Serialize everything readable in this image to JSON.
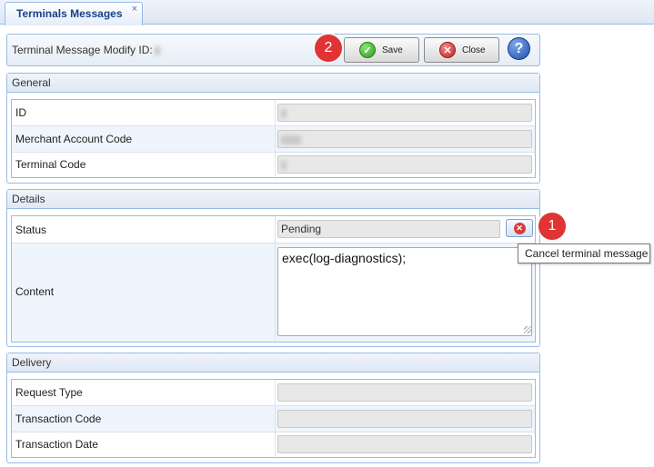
{
  "tab": {
    "title": "Terminals Messages",
    "close_glyph": "×"
  },
  "toolbar": {
    "title": "Terminal Message Modify ID:",
    "save_label": "Save",
    "close_label": "Close",
    "help_glyph": "?",
    "badge_save": "2"
  },
  "general": {
    "header": "General",
    "rows": [
      {
        "label": "ID"
      },
      {
        "label": "Merchant Account Code"
      },
      {
        "label": "Terminal Code"
      }
    ]
  },
  "details": {
    "header": "Details",
    "status_label": "Status",
    "status_value": "Pending",
    "content_label": "Content",
    "content_value": "exec(log-diagnostics);",
    "badge_cancel": "1",
    "cancel_tooltip": "Cancel terminal message"
  },
  "delivery": {
    "header": "Delivery",
    "rows": [
      {
        "label": "Request Type",
        "value": ""
      },
      {
        "label": "Transaction Code",
        "value": ""
      },
      {
        "label": "Transaction Date",
        "value": ""
      }
    ]
  },
  "icons": {
    "save": "check-circle-icon",
    "close": "x-circle-icon",
    "help": "question-icon",
    "cancel": "cancel-circle-icon"
  },
  "colors": {
    "accent_border": "#99bbe8",
    "tab_text": "#15428b",
    "badge": "#e03434"
  }
}
